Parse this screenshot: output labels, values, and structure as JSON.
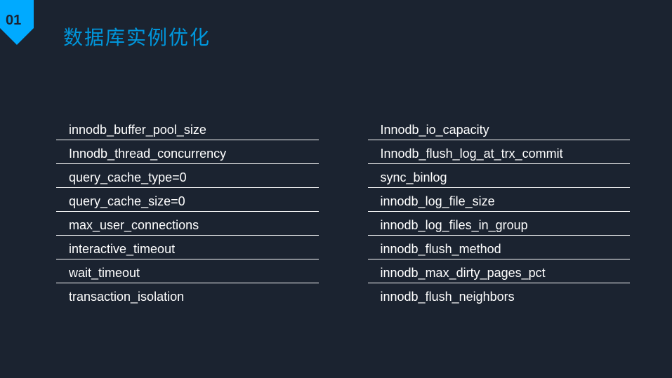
{
  "badge": "01",
  "title": "数据库实例优化",
  "left": {
    "items": [
      "innodb_buffer_pool_size",
      "Innodb_thread_concurrency",
      "query_cache_type=0",
      "query_cache_size=0",
      "max_user_connections",
      "interactive_timeout",
      "wait_timeout",
      "transaction_isolation"
    ]
  },
  "right": {
    "items": [
      "Innodb_io_capacity",
      "Innodb_flush_log_at_trx_commit",
      "sync_binlog",
      "innodb_log_file_size",
      "innodb_log_files_in_group",
      "innodb_flush_method",
      "innodb_max_dirty_pages_pct",
      "innodb_flush_neighbors"
    ]
  }
}
